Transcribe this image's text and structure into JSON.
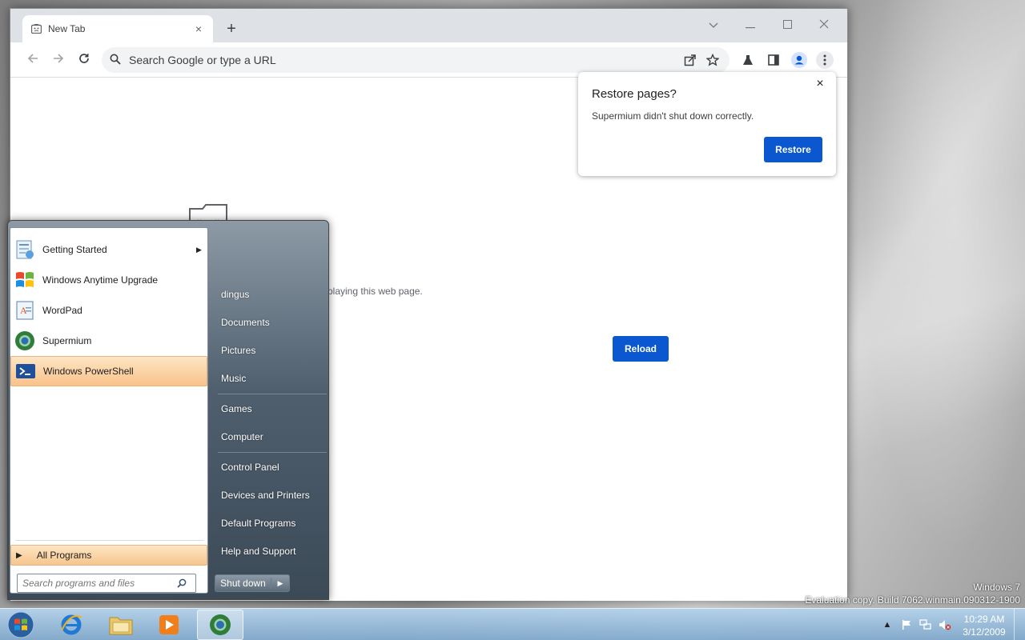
{
  "browser": {
    "tab_title": "New Tab",
    "tab_close": "×",
    "new_tab": "+",
    "omnibox_placeholder": "Search Google or type a URL",
    "error_text": "playing this web page.",
    "reload_label": "Reload"
  },
  "restore_bubble": {
    "title": "Restore pages?",
    "message": "Supermium didn't shut down correctly.",
    "restore_label": "Restore",
    "close": "×"
  },
  "start_menu": {
    "programs": [
      {
        "label": "Getting Started",
        "has_submenu": true
      },
      {
        "label": "Windows Anytime Upgrade",
        "has_submenu": false
      },
      {
        "label": "WordPad",
        "has_submenu": false
      },
      {
        "label": "Supermium",
        "has_submenu": false
      },
      {
        "label": "Windows PowerShell",
        "has_submenu": false,
        "highlighted": true
      }
    ],
    "all_programs": "All Programs",
    "search_placeholder": "Search programs and files",
    "right_items": [
      "dingus",
      "Documents",
      "Pictures",
      "Music",
      "Games",
      "Computer",
      "Control Panel",
      "Devices and Printers",
      "Default Programs",
      "Help and Support"
    ],
    "shutdown_label": "Shut down"
  },
  "watermark": {
    "line1": "Windows 7",
    "line2": "Evaluation copy. Build 7062.winmain.090312-1900"
  },
  "taskbar": {
    "time": "10:29 AM",
    "date": "3/12/2009",
    "apps": [
      "internet-explorer",
      "windows-explorer",
      "media-player",
      "supermium"
    ]
  },
  "colors": {
    "accent_blue": "#0b57d0",
    "highlight_orange": "#f9c28a"
  }
}
